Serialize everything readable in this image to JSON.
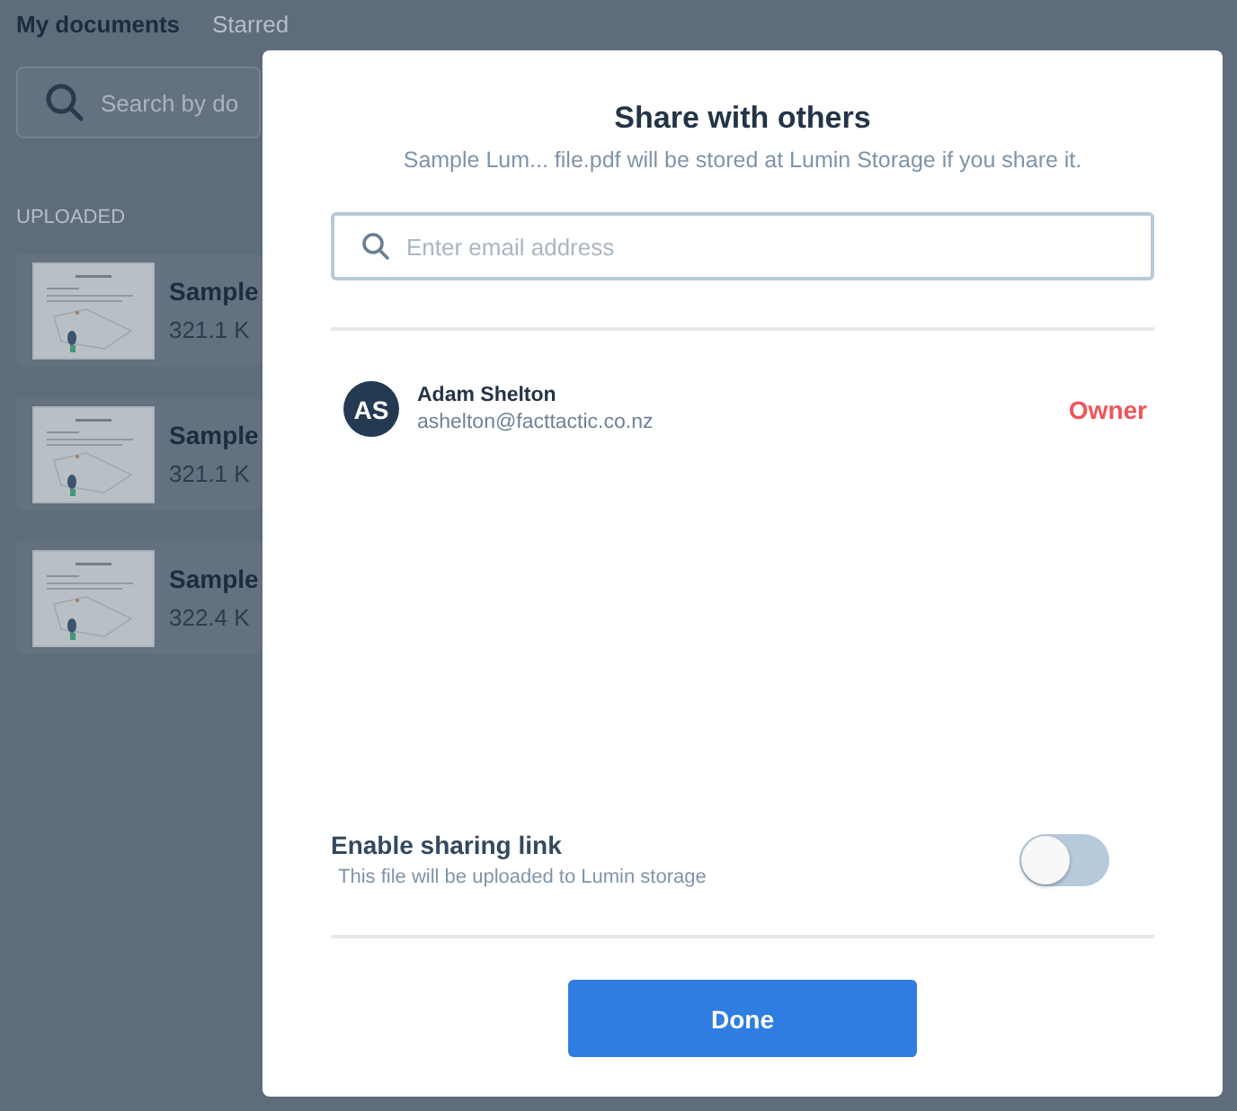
{
  "tabs": [
    {
      "label": "My documents",
      "selected": true
    },
    {
      "label": "Starred",
      "selected": false
    }
  ],
  "search": {
    "placeholder": "Search by do"
  },
  "section_label": "UPLOADED",
  "files": [
    {
      "name": "Sample",
      "size": "321.1 K"
    },
    {
      "name": "Sample",
      "size": "321.1 K"
    },
    {
      "name": "Sample",
      "size": "322.4 K"
    }
  ],
  "dialog": {
    "title": "Share with others",
    "subtitle": "Sample Lum... file.pdf will be stored at Lumin Storage if you share it.",
    "email_field": {
      "placeholder": "Enter email address"
    },
    "members": [
      {
        "initials": "AS",
        "name": "Adam Shelton",
        "email": "ashelton@facttactic.co.nz",
        "role": "Owner"
      }
    ],
    "sharing_link": {
      "label": "Enable sharing link",
      "hint": "This file will be uploaded to Lumin storage",
      "on": false
    },
    "done_button": "Done"
  }
}
